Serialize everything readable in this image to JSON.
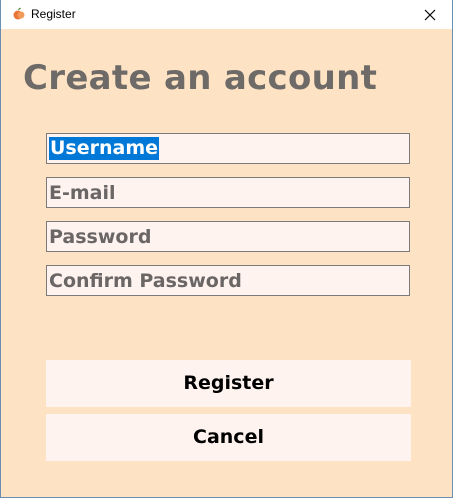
{
  "window": {
    "title": "Register"
  },
  "heading": "Create an account",
  "fields": {
    "username": {
      "value": "Username"
    },
    "email": {
      "value": "E-mail"
    },
    "password": {
      "value": "Password"
    },
    "confirm_password": {
      "value": "Confirm Password"
    }
  },
  "buttons": {
    "register": "Register",
    "cancel": "Cancel"
  },
  "colors": {
    "background": "#fde3c4",
    "field_background": "#fff3ef",
    "heading": "#6e6a67",
    "selection": "#0078d7"
  },
  "icons": {
    "app": "app-logo-icon",
    "close": "close-icon"
  }
}
